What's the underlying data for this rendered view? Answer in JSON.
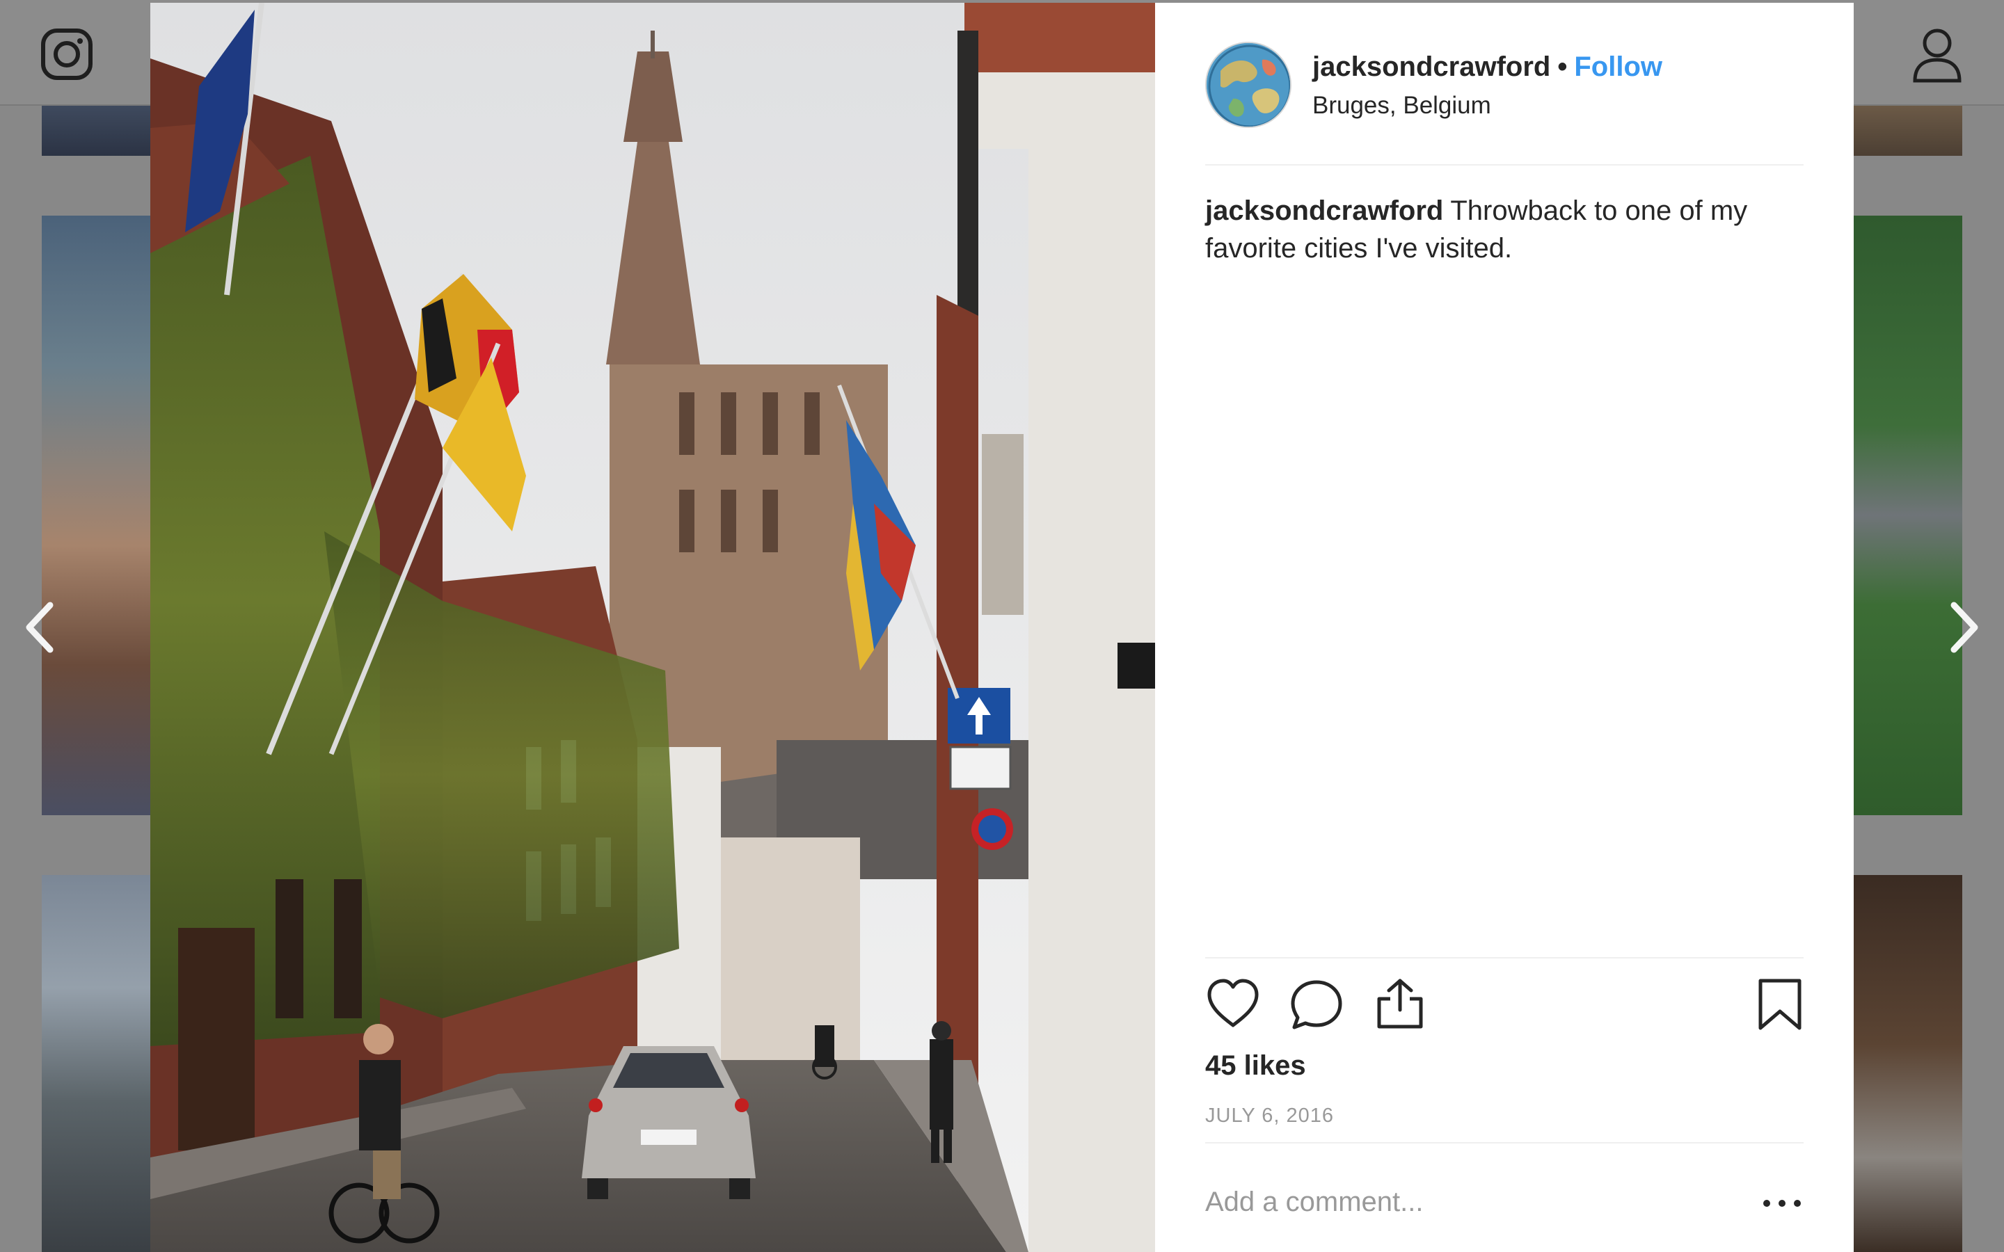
{
  "post": {
    "username": "jacksondcrawford",
    "follow_label": "Follow",
    "separator": "•",
    "location": "Bruges, Belgium",
    "caption_user": "jacksondcrawford",
    "caption_text": "Throwback to one of my favorite cities I've visited.",
    "likes": "45 likes",
    "date": "JULY 6, 2016"
  },
  "comment": {
    "placeholder": "Add a comment..."
  },
  "icons": {
    "logo": "instagram-logo-icon",
    "profile": "user-profile-icon",
    "prev": "chevron-left-icon",
    "next": "chevron-right-icon",
    "like": "heart-icon",
    "comment": "comment-bubble-icon",
    "share": "share-upload-icon",
    "save": "bookmark-icon",
    "more": "more-options-icon"
  },
  "colors": {
    "follow": "#3897f0",
    "text": "#262626",
    "muted": "#999999",
    "overlay": "#888888"
  }
}
